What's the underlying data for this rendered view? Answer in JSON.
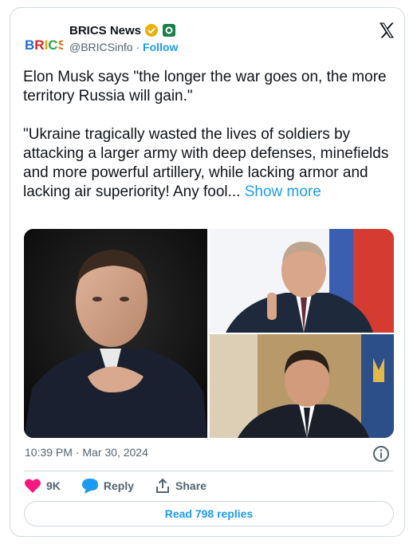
{
  "author": {
    "display_name": "BRICS News",
    "handle": "@BRICSinfo",
    "separator": "·",
    "follow_label": "Follow",
    "avatar_text": "BRICS",
    "verified_icon": "gold-verified-badge-icon",
    "affiliation_icon": "green-flag-badge-icon"
  },
  "tweet": {
    "text": "Elon Musk says \"the longer the war goes on, the more territory Russia will gain.\"\n\n\"Ukraine tragically wasted the lives of soldiers by attacking a larger army with deep defenses, minefields and more powerful artillery, while lacking armor and lacking air superiority! Any fool...",
    "show_more_label": "Show more"
  },
  "timestamp": "10:39 PM · Mar 30, 2024",
  "actions": {
    "likes_count": "9K",
    "reply_label": "Reply",
    "share_label": "Share"
  },
  "read_replies_label": "Read 798 replies",
  "colors": {
    "accent": "#1d9bf0",
    "like": "#f91880",
    "text": "#0f1419",
    "muted": "#536471",
    "border": "#cfd9de"
  }
}
